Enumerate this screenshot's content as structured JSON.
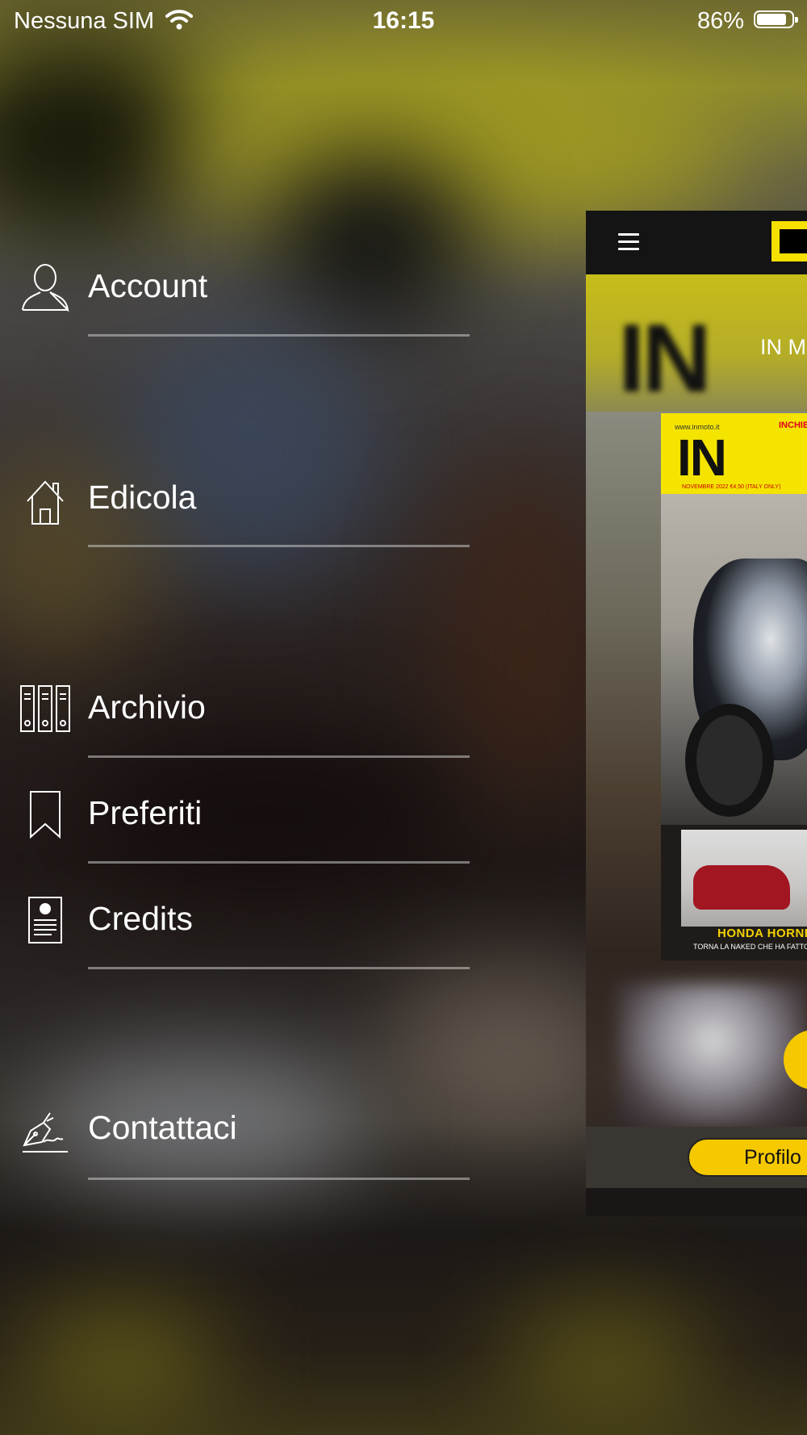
{
  "status_bar": {
    "carrier": "Nessuna SIM",
    "time": "16:15",
    "battery_percent": "86%",
    "battery_level": 0.86,
    "wifi_icon": "wifi-icon"
  },
  "menu": {
    "items": [
      {
        "label": "Account",
        "icon": "user-icon"
      },
      {
        "label": "Edicola",
        "icon": "home-icon"
      },
      {
        "label": "Archivio",
        "icon": "archive-binders-icon"
      },
      {
        "label": "Preferiti",
        "icon": "bookmark-icon"
      },
      {
        "label": "Credits",
        "icon": "credits-document-icon"
      },
      {
        "label": "Contattaci",
        "icon": "pen-signature-icon"
      }
    ]
  },
  "preview": {
    "menu_icon": "hamburger-icon",
    "banner_big_text": "IN",
    "banner_title": "IN M",
    "cover": {
      "url": "www.inmoto.it",
      "masthead": "IN",
      "tag": "INCHIE",
      "date": "NOVEMBRE 2022 €4,50 (ITALY ONLY)",
      "headline": "HONDA HORNET",
      "subheadline": "TORNA LA NAKED CHE HA FATTO LA"
    },
    "profile_button": "Profilo"
  },
  "colors": {
    "accent_yellow": "#f5c800",
    "logo_yellow": "#f5e000"
  }
}
